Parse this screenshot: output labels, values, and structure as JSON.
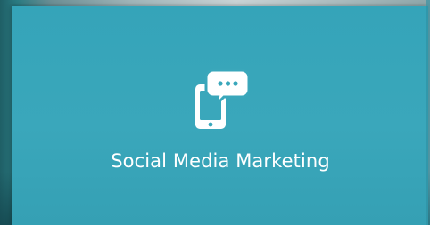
{
  "card": {
    "icon": "mobile-chat-icon",
    "title": "Social Media Marketing",
    "colors": {
      "background": "#3aa7bb",
      "text": "#ffffff"
    }
  }
}
